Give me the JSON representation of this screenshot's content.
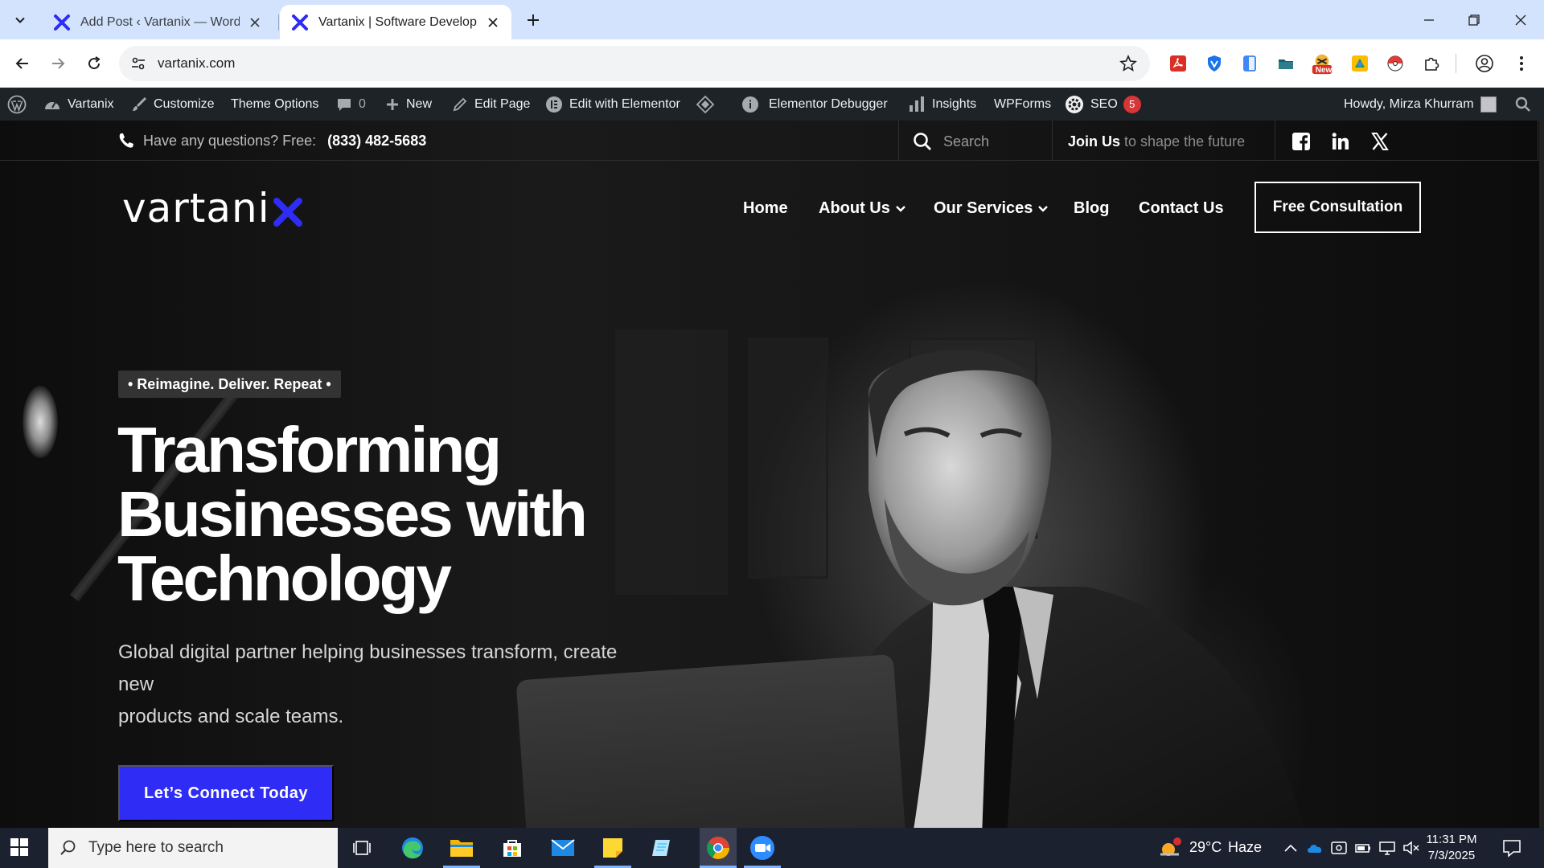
{
  "browser": {
    "tabs": [
      {
        "title": "Add Post ‹ Vartanix — WordPress",
        "active": false
      },
      {
        "title": "Vartanix | Software Development",
        "active": true
      }
    ],
    "url": "vartanix.com",
    "extensions": [
      "pdf-extension-icon",
      "shield-extension-icon",
      "document-extension-icon",
      "folder-extension-icon",
      "new-badge-extension-icon",
      "yellow-extension-icon",
      "pokeball-extension-icon",
      "puzzle-icon"
    ],
    "new_badge": "New"
  },
  "adminbar": {
    "site": "Vartanix",
    "customize": "Customize",
    "theme_options": "Theme Options",
    "comments": "0",
    "new": "New",
    "edit_page": "Edit Page",
    "edit_elementor": "Edit with Elementor",
    "debugger": "Elementor Debugger",
    "insights": "Insights",
    "wpforms": "WPForms",
    "seo": "SEO",
    "seo_count": "5",
    "howdy": "Howdy, Mirza Khurram"
  },
  "topbar": {
    "question": "Have any questions? Free:",
    "phone": "(833) 482-5683",
    "search_placeholder": "Search",
    "join_bold": "Join Us",
    "join_rest": " to shape the future"
  },
  "logo": {
    "text": "vartani"
  },
  "nav": {
    "home": "Home",
    "about": "About Us",
    "services": "Our Services",
    "blog": "Blog",
    "contact": "Contact Us",
    "cta": "Free Consultation"
  },
  "hero": {
    "tagline": "• Reimagine. Deliver. Repeat •",
    "title_lines": [
      "Transforming",
      "Businesses with",
      "Technology"
    ],
    "subtitle_lines": [
      "Global digital partner helping businesses transform, create",
      "new",
      "products and scale teams."
    ],
    "cta": "Let’s Connect Today"
  },
  "colors": {
    "brand_blue": "#2f2cf5",
    "admin_bar": "#1d2327",
    "tab_strip": "#d3e3fd"
  },
  "taskbar": {
    "search_placeholder": "Type here to search",
    "weather_temp": "29°C",
    "weather_desc": "Haze",
    "time": "11:31 PM",
    "date": "7/3/2025"
  }
}
